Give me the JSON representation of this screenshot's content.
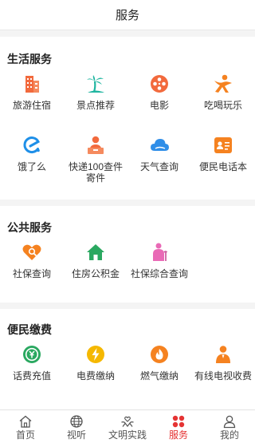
{
  "header": {
    "title": "服务"
  },
  "sections": [
    {
      "title": "生活服务",
      "items": [
        {
          "label": "旅游住宿",
          "icon": "hotel-building-icon",
          "color": "#f26a3d"
        },
        {
          "label": "景点推荐",
          "icon": "palm-tree-icon",
          "color": "#1fb5a0"
        },
        {
          "label": "电影",
          "icon": "film-reel-icon",
          "color": "#f26a3d"
        },
        {
          "label": "吃喝玩乐",
          "icon": "person-fun-icon",
          "color": "#f58220"
        },
        {
          "label": "饿了么",
          "icon": "eleme-logo-icon",
          "color": "#1e8fe8"
        },
        {
          "label": "快递100查件寄件",
          "icon": "courier-icon",
          "color": "#f26a3d"
        },
        {
          "label": "天气查询",
          "icon": "cloud-icon",
          "color": "#2f8ee8"
        },
        {
          "label": "便民电话本",
          "icon": "phonebook-icon",
          "color": "#f58220"
        }
      ]
    },
    {
      "title": "公共服务",
      "items": [
        {
          "label": "社保查询",
          "icon": "heart-search-icon",
          "color": "#f58220"
        },
        {
          "label": "住房公积金",
          "icon": "house-icon",
          "color": "#2aa860"
        },
        {
          "label": "社保综合查询",
          "icon": "elderly-person-icon",
          "color": "#e96ab6"
        }
      ]
    },
    {
      "title": "便民缴费",
      "items": [
        {
          "label": "话费充值",
          "icon": "phone-recharge-icon",
          "color": "#2aa860"
        },
        {
          "label": "电费缴纳",
          "icon": "lightning-icon",
          "color": "#f5b800"
        },
        {
          "label": "燃气缴纳",
          "icon": "gas-flame-icon",
          "color": "#f58220"
        },
        {
          "label": "有线电视收费",
          "icon": "cable-tv-person-icon",
          "color": "#f58220"
        }
      ]
    }
  ],
  "tabbar": {
    "active_color": "#e53333",
    "items": [
      {
        "label": "首页",
        "icon": "home-icon"
      },
      {
        "label": "视听",
        "icon": "globe-icon"
      },
      {
        "label": "文明实践",
        "icon": "hands-heart-icon"
      },
      {
        "label": "服务",
        "icon": "grid-dots-icon",
        "active": true
      },
      {
        "label": "我的",
        "icon": "user-icon"
      }
    ]
  }
}
